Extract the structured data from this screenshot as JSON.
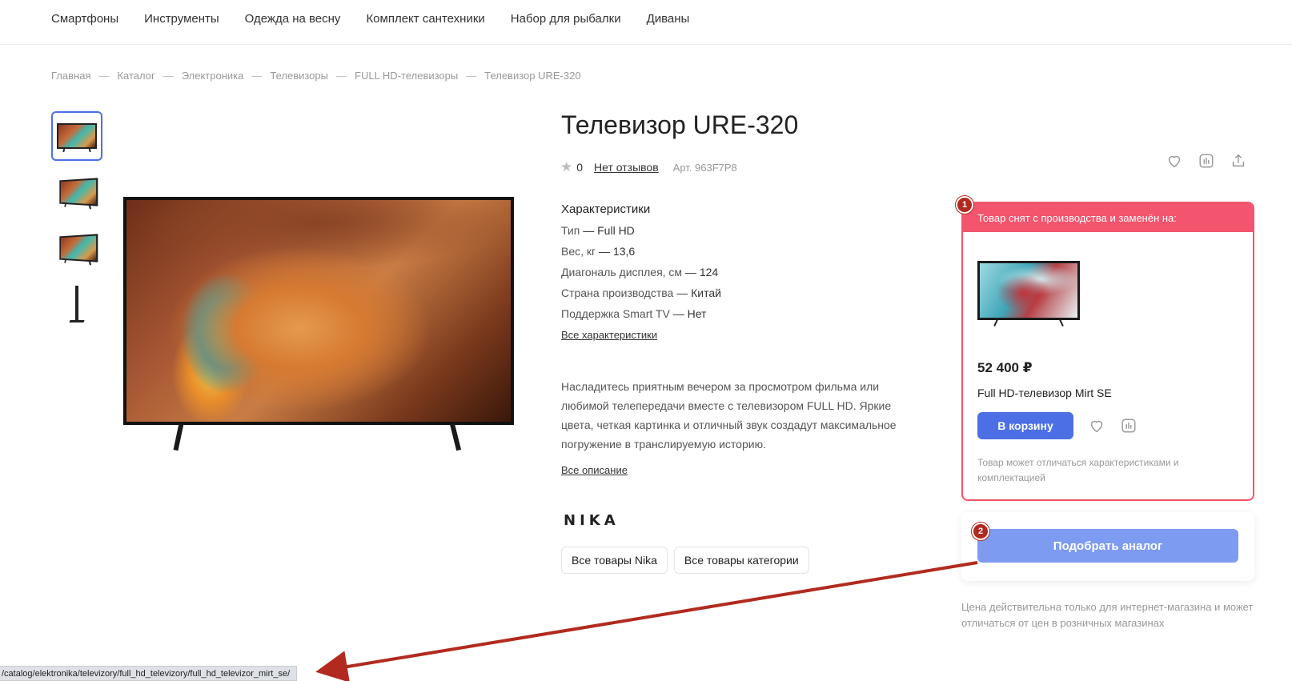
{
  "nav": {
    "items": [
      "Смартфоны",
      "Инструменты",
      "Одежда на весну",
      "Комплект сантехники",
      "Набор для рыбалки",
      "Диваны"
    ]
  },
  "breadcrumb": {
    "items": [
      "Главная",
      "Каталог",
      "Электроника",
      "Телевизоры",
      "FULL HD-телевизоры",
      "Телевизор URE-320"
    ],
    "separator": "—"
  },
  "product": {
    "title": "Телевизор URE-320",
    "rating": "0",
    "reviews_label": "Нет отзывов",
    "sku": "Арт. 963F7P8"
  },
  "specs": {
    "heading": "Характеристики",
    "rows": [
      {
        "key": "Тип",
        "value": "Full HD"
      },
      {
        "key": "Вес, кг",
        "value": "13,6"
      },
      {
        "key": "Диагональ дисплея, см",
        "value": "124"
      },
      {
        "key": "Страна производства",
        "value": "Китай"
      },
      {
        "key": "Поддержка Smart TV",
        "value": "Нет"
      }
    ],
    "dash": "—",
    "all_link": "Все характеристики"
  },
  "description": {
    "text": "Насладитесь приятным вечером за просмотром фильма или любимой телепередачи вместе с телевизором FULL HD. Яркие цвета, четкая картинка и отличный звук создадут максимальное погружение в транслируемую историю.",
    "all_link": "Все описание"
  },
  "brand": {
    "logo": "NIKA",
    "buttons": [
      "Все товары Nika",
      "Все товары категории"
    ]
  },
  "notice": {
    "header": "Товар снят с производства и заменён на:",
    "replacement_price": "52 400 ₽",
    "replacement_name": "Full HD-телевизор Mirt SE",
    "cart_button": "В корзину",
    "note": "Товар может отличаться характеристиками и комплектацией"
  },
  "analog": {
    "button": "Подобрать аналог"
  },
  "price_note": "Цена действительна только для интернет-магазина и может отличаться от цен в розничных магазинах",
  "annotations": {
    "badge1": "1",
    "badge2": "2",
    "arrow_color": "#b22a1f"
  },
  "statusbar": {
    "url": "/catalog/elektronika/televizory/full_hd_televizory/full_hd_televizor_mirt_se/"
  },
  "colors": {
    "accent": "#4d6fe6",
    "alert": "#f2556d",
    "analog_button": "#7e9bf2"
  },
  "icons": {
    "top_actions": [
      "heart-icon",
      "compare-icon",
      "share-icon"
    ],
    "card_actions": [
      "heart-icon",
      "compare-icon"
    ],
    "rating": "star-icon"
  }
}
